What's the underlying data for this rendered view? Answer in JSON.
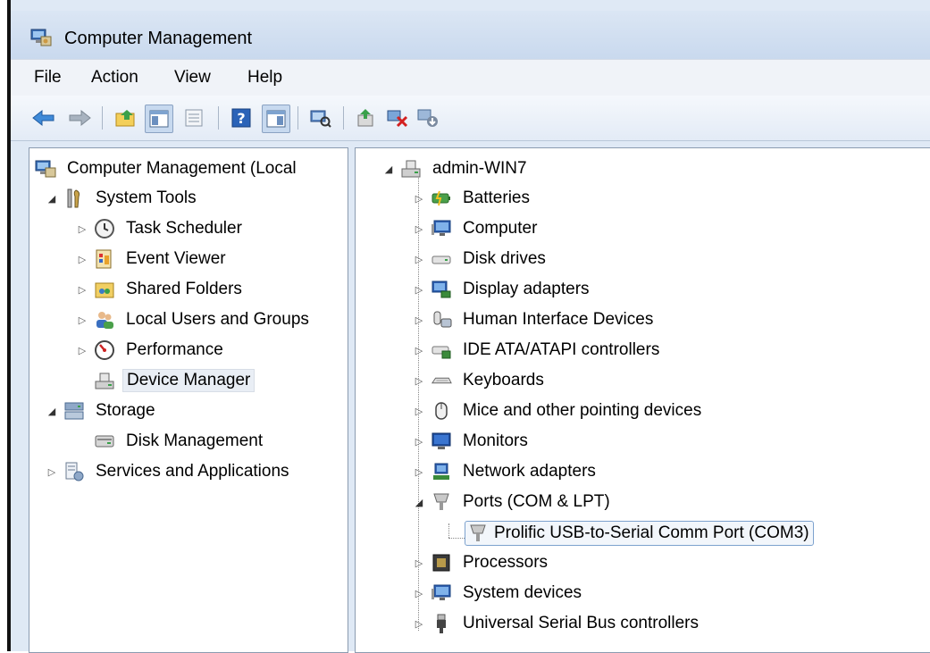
{
  "window": {
    "title": "Computer Management"
  },
  "menu": [
    "File",
    "Action",
    "View",
    "Help"
  ],
  "toolbar": {
    "icons": [
      "back-arrow-icon",
      "forward-arrow-icon",
      "up-folder-icon",
      "show-hide-tree-icon",
      "properties-icon",
      "help-icon",
      "show-hide-action-pane-icon",
      "scan-hardware-icon",
      "update-driver-icon",
      "uninstall-device-icon",
      "disable-device-icon"
    ]
  },
  "left_tree": {
    "root": "Computer Management (Local",
    "system_tools": "System Tools",
    "task_scheduler": "Task Scheduler",
    "event_viewer": "Event Viewer",
    "shared_folders": "Shared Folders",
    "local_users": "Local Users and Groups",
    "performance": "Performance",
    "device_manager": "Device Manager",
    "storage": "Storage",
    "disk_management": "Disk Management",
    "services": "Services and Applications"
  },
  "device_tree": {
    "root": "admin-WIN7",
    "items": [
      "Batteries",
      "Computer",
      "Disk drives",
      "Display adapters",
      "Human Interface Devices",
      "IDE ATA/ATAPI controllers",
      "Keyboards",
      "Mice and other pointing devices",
      "Monitors",
      "Network adapters",
      "Ports (COM & LPT)"
    ],
    "port_child": "Prolific USB-to-Serial Comm Port (COM3)",
    "items_after": [
      "Processors",
      "System devices",
      "Universal Serial Bus controllers"
    ]
  }
}
